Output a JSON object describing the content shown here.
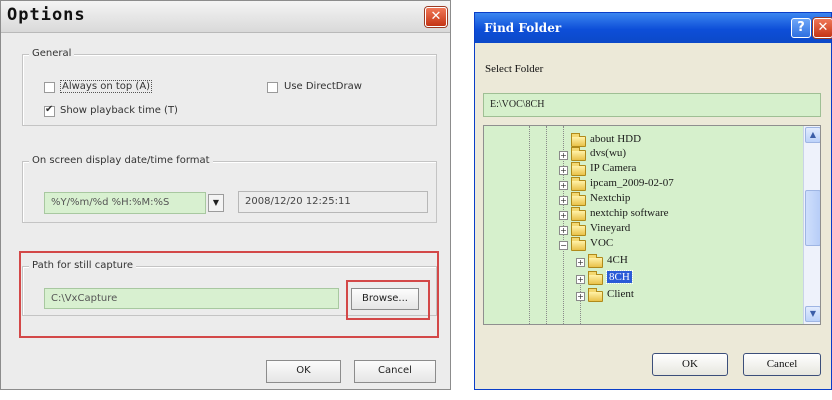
{
  "options_dialog": {
    "title": "Options",
    "close_glyph": "✕",
    "general": {
      "label": "General",
      "always_on_top": {
        "label": "Always on top (A)",
        "checked": false
      },
      "use_directdraw": {
        "label": "Use DirectDraw",
        "checked": false
      },
      "show_playback_time": {
        "label": "Show playback time (T)",
        "checked": true
      }
    },
    "osd": {
      "label": "On screen display date/time format",
      "format_value": "%Y/%m/%d %H:%M:%S",
      "dropdown_arrow": "▼",
      "preview": "2008/12/20 12:25:11"
    },
    "still_capture": {
      "label": "Path for still capture",
      "path_value": "C:\\VxCapture",
      "browse_label": "Browse..."
    },
    "ok_label": "OK",
    "cancel_label": "Cancel",
    "highlight_color": "#d34848"
  },
  "find_folder_dialog": {
    "title": "Find Folder",
    "help_glyph": "?",
    "close_glyph": "✕",
    "select_label": "Select Folder",
    "path_value": "E:\\VOC\\8CH",
    "tree_items": [
      {
        "label": "about HDD",
        "expander": ""
      },
      {
        "label": "dvs(wu)",
        "expander": "+"
      },
      {
        "label": "IP Camera",
        "expander": "+"
      },
      {
        "label": "ipcam_2009-02-07",
        "expander": "+"
      },
      {
        "label": "Nextchip",
        "expander": "+"
      },
      {
        "label": "nextchip software",
        "expander": "+"
      },
      {
        "label": "Vineyard",
        "expander": "+"
      },
      {
        "label": "VOC",
        "expander": "−"
      },
      {
        "label": "4CH",
        "expander": "+"
      },
      {
        "label": "8CH",
        "expander": "+"
      },
      {
        "label": "Client",
        "expander": "+"
      }
    ],
    "scroll_up_glyph": "▲",
    "scroll_down_glyph": "▼",
    "ok_label": "OK",
    "cancel_label": "Cancel",
    "titlebar_color": "#0d4ed8"
  }
}
